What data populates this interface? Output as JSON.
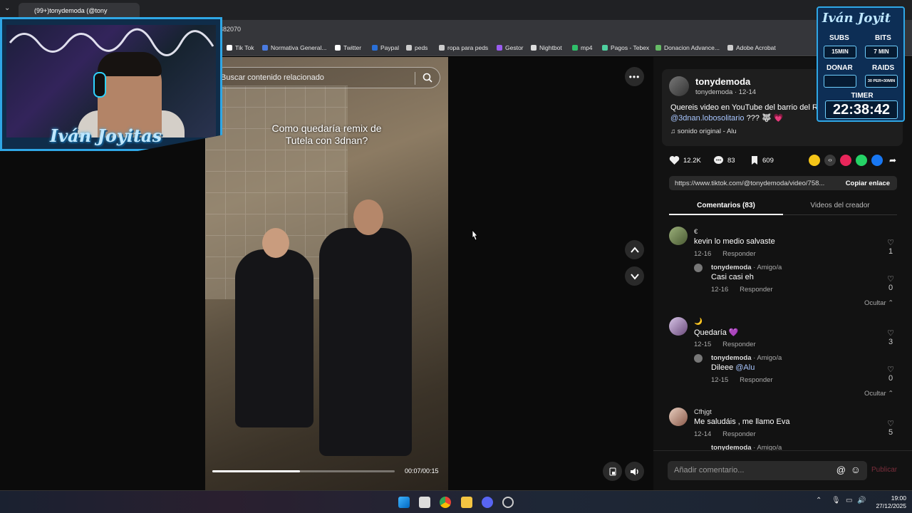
{
  "browser": {
    "tab_title": "(99+)tonydemoda (@tony",
    "url_fragment": "382070",
    "bookmarks": [
      {
        "label": "Tik Tok",
        "color": "#ffffff"
      },
      {
        "label": "Normativa General...",
        "color": "#4a7be0"
      },
      {
        "label": "Twitter",
        "color": "#ffffff"
      },
      {
        "label": "Paypal",
        "color": "#2a6fd6"
      },
      {
        "label": "peds",
        "color": "#cccccc"
      },
      {
        "label": "ropa para peds",
        "color": "#cccccc"
      },
      {
        "label": "Gestor",
        "color": "#9a5cf0"
      },
      {
        "label": "Nightbot",
        "color": "#dddddd"
      },
      {
        "label": "mp4",
        "color": "#2fbf6a"
      },
      {
        "label": "Pagos - Tebex",
        "color": "#4fd0a0"
      },
      {
        "label": "Donacion Advance...",
        "color": "#66bb66"
      },
      {
        "label": "Adobe Acrobat",
        "color": "#cccccc"
      }
    ]
  },
  "video": {
    "search_placeholder": "Buscar contenido relacionado",
    "overlay_text_line1": "Como quedaría remix de",
    "overlay_text_line2": "Tutela con 3dnan?",
    "progress_fraction": 0.48,
    "time": "00:07/00:15"
  },
  "post": {
    "username": "tonydemoda",
    "subline": "tonydemoda · 12-14",
    "description": "Quereis video en YouTube del barrio del R",
    "mention": "@3dnan.lobosolitario",
    "mention_suffix": " ??? 🐺 💗",
    "sound": "sonido original - Alu",
    "likes": "12.2K",
    "comments_count": "83",
    "saves": "609",
    "link": "https://www.tiktok.com/@tonydemoda/video/758...",
    "copy_label": "Copiar enlace",
    "tab_comments": "Comentarios (83)",
    "tab_creator": "Videos del creador",
    "comment_placeholder": "Añadir comentario...",
    "publish_label": "Publicar"
  },
  "comments": [
    {
      "name": "€",
      "text": "kevin lo medio salvaste",
      "date": "12-16",
      "reply": "Responder",
      "likes": "1",
      "sub": {
        "name": "tonydemoda",
        "tag": " · Amigo/a",
        "text": "Casi casi eh",
        "date": "12-16",
        "reply": "Responder",
        "likes": "0"
      },
      "hide": "Ocultar"
    },
    {
      "name": "🌙",
      "text": "Quedaría 💜",
      "date": "12-15",
      "reply": "Responder",
      "likes": "3",
      "sub": {
        "name": "tonydemoda",
        "tag": " · Amigo/a",
        "text": "Dileee",
        "mention": "@Alu",
        "date": "12-15",
        "reply": "Responder",
        "likes": "0"
      },
      "hide": "Ocultar"
    },
    {
      "name": "Cfhjgt",
      "text": "Me saludáis , me llamo Eva",
      "date": "12-14",
      "reply": "Responder",
      "likes": "5",
      "sub": {
        "name": "tonydemoda",
        "tag": " · Amigo/a"
      }
    }
  ],
  "stream": {
    "cam_logo": "Iván Joyitas",
    "widget_title": "Iván Joyit",
    "subs_label": "SUBS",
    "subs_value": "15MIN",
    "bits_label": "BITS",
    "bits_value": "7 MIN",
    "donar_label": "DONAR",
    "donar_value": "",
    "raids_label": "RAIDS",
    "raids_value": "30 PER=30MIN",
    "timer_label": "TIMER",
    "timer_value": "22:38:42"
  },
  "taskbar": {
    "time": "19:00",
    "date": "27/12/2025"
  }
}
